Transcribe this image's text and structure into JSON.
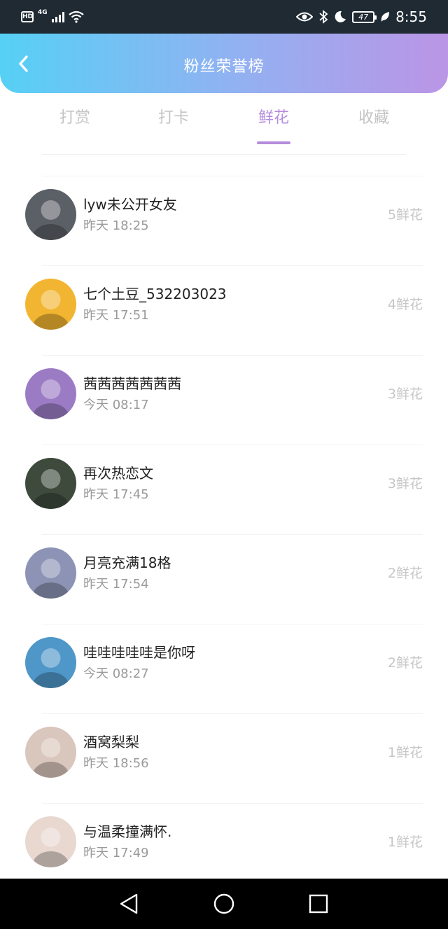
{
  "status_bar": {
    "hd": "HD",
    "network": "4G",
    "battery": "47",
    "time": "8:55",
    "icons": [
      "wifi-icon",
      "eye-icon",
      "bluetooth-icon",
      "moon-icon",
      "leaf-icon"
    ]
  },
  "header": {
    "title": "粉丝荣誉榜",
    "back_icon": "chevron-left-icon"
  },
  "tabs": [
    {
      "label": "打赏",
      "active": false
    },
    {
      "label": "打卡",
      "active": false
    },
    {
      "label": "鲜花",
      "active": true
    },
    {
      "label": "收藏",
      "active": false
    }
  ],
  "fans": [
    {
      "name": "lyw未公开女友",
      "time": "昨天 18:25",
      "count": "5鲜花",
      "avatar_color": "#5b5f66"
    },
    {
      "name": "七个土豆_532203023",
      "time": "昨天 17:51",
      "count": "4鲜花",
      "avatar_color": "#f2b531"
    },
    {
      "name": "茜茜茜茜茜茜茜",
      "time": "今天 08:17",
      "count": "3鲜花",
      "avatar_color": "#9b7cc4"
    },
    {
      "name": "再次热恋文",
      "time": "昨天 17:45",
      "count": "3鲜花",
      "avatar_color": "#3d4a3c"
    },
    {
      "name": "月亮充满18格",
      "time": "昨天 17:54",
      "count": "2鲜花",
      "avatar_color": "#8c93b4"
    },
    {
      "name": "哇哇哇哇哇是你呀",
      "time": "今天 08:27",
      "count": "2鲜花",
      "avatar_color": "#4f97c9"
    },
    {
      "name": "酒窝梨梨",
      "time": "昨天 18:56",
      "count": "1鲜花",
      "avatar_color": "#d9c6bc"
    },
    {
      "name": "与温柔撞满怀.",
      "time": "昨天 17:49",
      "count": "1鲜花",
      "avatar_color": "#e8d8d0"
    }
  ],
  "nav_bar": {
    "icons": [
      "back-triangle-icon",
      "home-circle-icon",
      "recents-square-icon"
    ]
  }
}
